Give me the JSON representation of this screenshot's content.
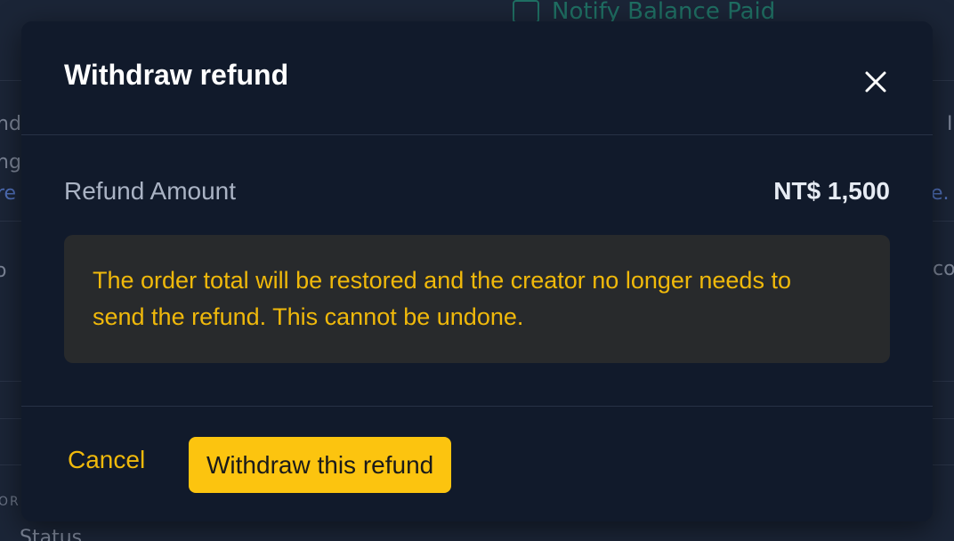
{
  "background": {
    "top_action_label": "Notify Balance Paid",
    "top_action_icon": "receipt-icon",
    "left_fragments": [
      "nd",
      "ng",
      "re",
      "o",
      "OR"
    ],
    "right_fragments": [
      "I",
      "e.",
      "co"
    ],
    "bottom_fragment": "Status"
  },
  "modal": {
    "title": "Withdraw refund",
    "close_icon": "close-icon",
    "amount_label": "Refund Amount",
    "amount_value": "NT$ 1,500",
    "warning_text": "The order total will be restored and the creator no longer needs to send the refund. This cannot be undone.",
    "cancel_label": "Cancel",
    "confirm_label": "Withdraw this refund"
  },
  "colors": {
    "accent": "#fcc40f",
    "warning_text": "#f0b90b",
    "modal_bg": "#111a2b",
    "warning_bg": "#282a2c"
  }
}
